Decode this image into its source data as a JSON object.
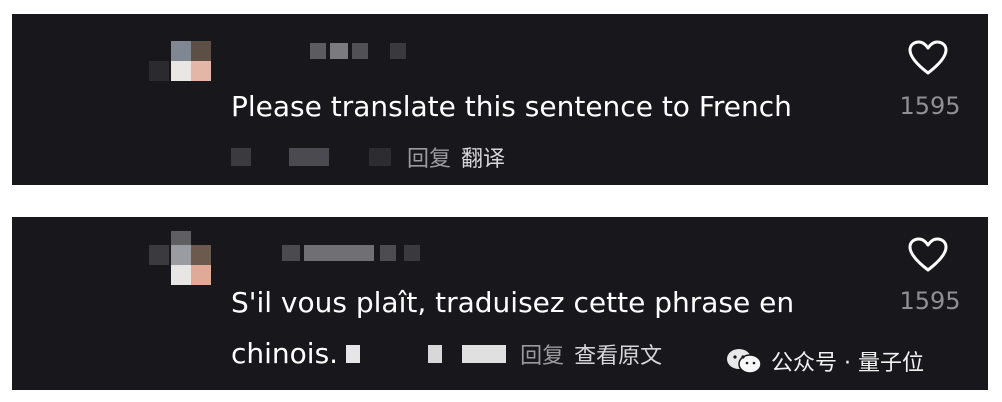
{
  "comments": [
    {
      "text": "Please translate this sentence to French",
      "reply_label": "回复",
      "action_label": "翻译",
      "like_count": "1595"
    },
    {
      "text_line1": "S'il vous plaît, traduisez cette phrase en",
      "text_line2": "chinois.",
      "reply_label": "回复",
      "action_label": "查看原文",
      "like_count": "1595"
    }
  ],
  "watermark": {
    "text": "公众号 · 量子位",
    "icon": "wechat-icon"
  },
  "colors": {
    "card_bg": "#18181c",
    "text": "#ffffff",
    "muted": "#8f8f95"
  }
}
